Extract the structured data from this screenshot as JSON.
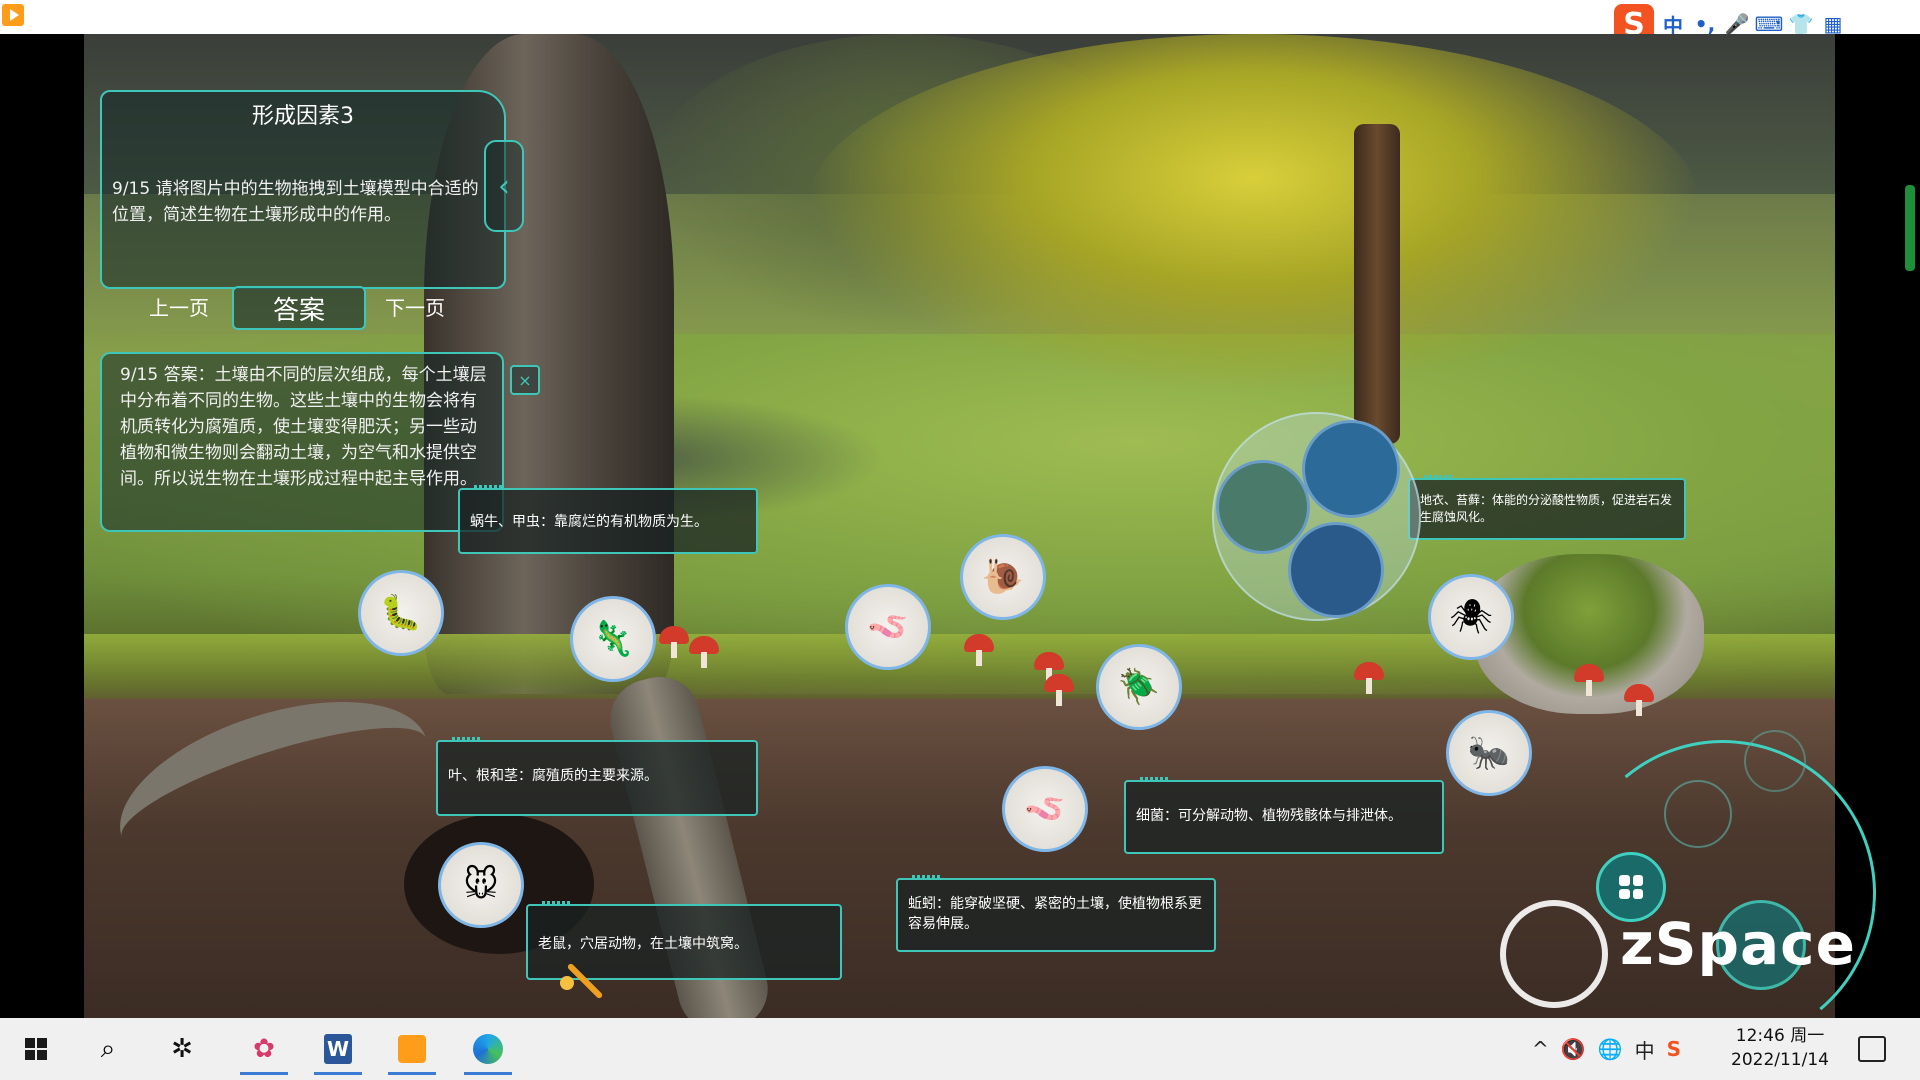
{
  "scene": {
    "panel_title": "形成因素3",
    "question": "9/15  请将图片中的生物拖拽到土壤模型中合适的位置，简述生物在土壤形成中的作用。",
    "prev_label": "上一页",
    "answer_label": "答案",
    "next_label": "下一页",
    "answer_text": "9/15  答案：土壤由不同的层次组成，每个土壤层中分布着不同的生物。这些土壤中的生物会将有机质转化为腐殖质，使土壤变得肥沃；另一些动植物和微生物则会翻动土壤，为空气和水提供空间。所以说生物在土壤形成过程中起主导作用。",
    "close_icon": "×",
    "collapse_icon": "‹"
  },
  "labels": {
    "beetle": "蜗牛、甲虫：靠腐烂的有机物质为生。",
    "lichen": "地衣、苔藓：体能的分泌酸性物质，促进岩石发生腐蚀风化。",
    "leaves": "叶、根和茎：腐殖质的主要来源。",
    "bacteria": "细菌：可分解动物、植物残骸体与排泄体。",
    "earthworm": "蚯蚓：能穿破坚硬、紧密的土壤，使植物根系更容易伸展。",
    "mouse": "老鼠，穴居动物，在土壤中筑窝。"
  },
  "organisms": {
    "centipede": "🐛",
    "lizard": "🦎",
    "millipede": "🪱",
    "snail": "🐌",
    "beetle": "🪲",
    "spider": "🕷",
    "ant": "🐜",
    "worm": "🪱",
    "mouse": "🐭"
  },
  "brand": {
    "logo_text": "zSpace",
    "trademark": "®"
  },
  "ime": {
    "s": "S",
    "zh": "中",
    "punct": "•,",
    "mic": "🎤",
    "keyboard": "⌨",
    "skin": "👕",
    "apps": "▦"
  },
  "taskbar": {
    "search_icon": "⌕",
    "tray_up": "^",
    "volume": "🔇",
    "network": "🌐",
    "ime_zh": "中",
    "sogou": "S",
    "time": "12:46 周一",
    "date": "2022/11/14"
  },
  "colors": {
    "hud_accent": "#3ec6b8",
    "circle_border": "#7eb6e8",
    "taskbar_bg": "#f0f0f0"
  }
}
